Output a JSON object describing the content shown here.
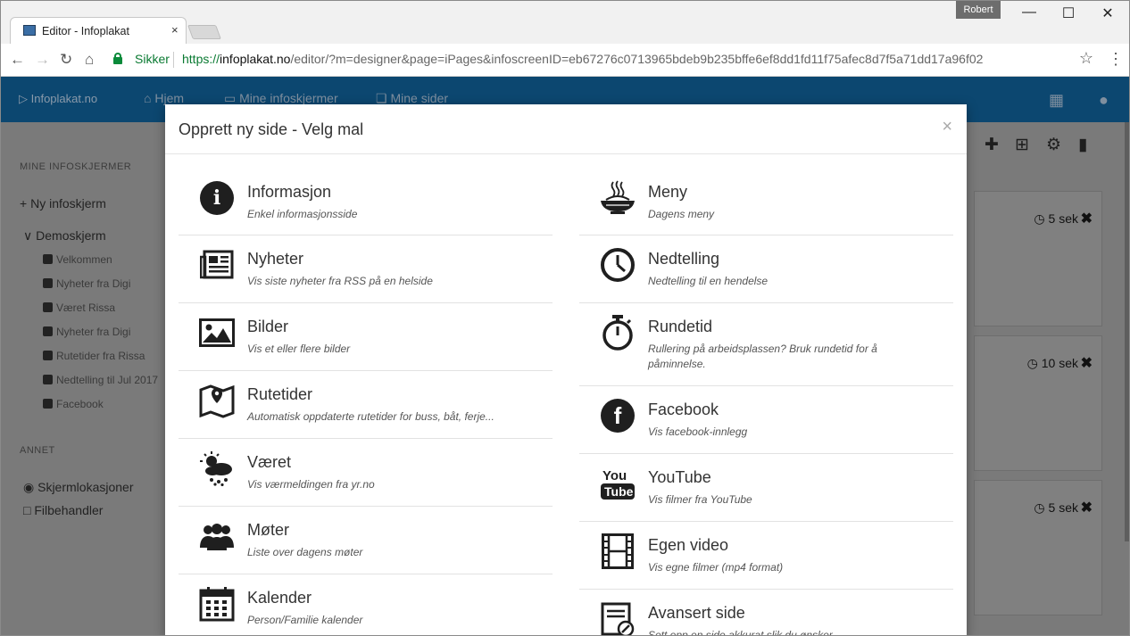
{
  "browser": {
    "tab_title": "Editor - Infoplakat",
    "tab_close": "×",
    "user_badge": "Robert",
    "secure_label": "Sikker",
    "url_scheme": "https://",
    "url_host": "infoplakat.no",
    "url_path": "/editor/?m=designer&page=iPages&infoscreenID=eb67276c0713965bdeb9b235bffe6ef8dd1fd11f75afec8d7f5a71dd17a96f02"
  },
  "app": {
    "brand": "Infoplakat.no",
    "nav": [
      "Hjem",
      "Mine infoskjermer",
      "Mine sider"
    ]
  },
  "sidebar": {
    "section1": "MINE INFOSKJERMER",
    "new_screen": "Ny infoskjerm",
    "group": "Demoskjerm",
    "pages": [
      "Velkommen",
      "Nyheter fra Digi",
      "Været Rissa",
      "Nyheter fra Digi",
      "Rutetider fra Rissa",
      "Nedtelling til Jul 2017",
      "Facebook"
    ],
    "section2": "ANNET",
    "other": [
      "Skjermlokasjoner",
      "Filbehandler"
    ]
  },
  "cards": [
    {
      "time": "5 sek"
    },
    {
      "time": "10 sek"
    },
    {
      "time": "5 sek"
    }
  ],
  "modal": {
    "title": "Opprett ny side - Velg mal",
    "close": "×",
    "left": [
      {
        "name": "Informasjon",
        "desc": "Enkel informasjonsside",
        "icon": "info-icon"
      },
      {
        "name": "Nyheter",
        "desc": "Vis siste nyheter fra RSS på en helside",
        "icon": "newspaper-icon"
      },
      {
        "name": "Bilder",
        "desc": "Vis et eller flere bilder",
        "icon": "image-icon"
      },
      {
        "name": "Rutetider",
        "desc": "Automatisk oppdaterte rutetider for buss, båt, ferje...",
        "icon": "map-icon"
      },
      {
        "name": "Været",
        "desc": "Vis værmeldingen fra yr.no",
        "icon": "weather-icon"
      },
      {
        "name": "Møter",
        "desc": "Liste over dagens møter",
        "icon": "people-icon"
      },
      {
        "name": "Kalender",
        "desc": "Person/Familie kalender",
        "icon": "calendar-icon"
      }
    ],
    "right": [
      {
        "name": "Meny",
        "desc": "Dagens meny",
        "icon": "food-bowl-icon"
      },
      {
        "name": "Nedtelling",
        "desc": "Nedtelling til en hendelse",
        "icon": "clock-icon"
      },
      {
        "name": "Rundetid",
        "desc": "Rullering på arbeidsplassen? Bruk rundetid for å påminnelse.",
        "icon": "stopwatch-icon"
      },
      {
        "name": "Facebook",
        "desc": "Vis facebook-innlegg",
        "icon": "facebook-icon"
      },
      {
        "name": "YouTube",
        "desc": "Vis filmer fra YouTube",
        "icon": "youtube-icon"
      },
      {
        "name": "Egen video",
        "desc": "Vis egne filmer (mp4 format)",
        "icon": "film-icon"
      },
      {
        "name": "Avansert side",
        "desc": "Sett opp en side akkurat slik du ønsker",
        "icon": "edit-page-icon"
      }
    ]
  }
}
